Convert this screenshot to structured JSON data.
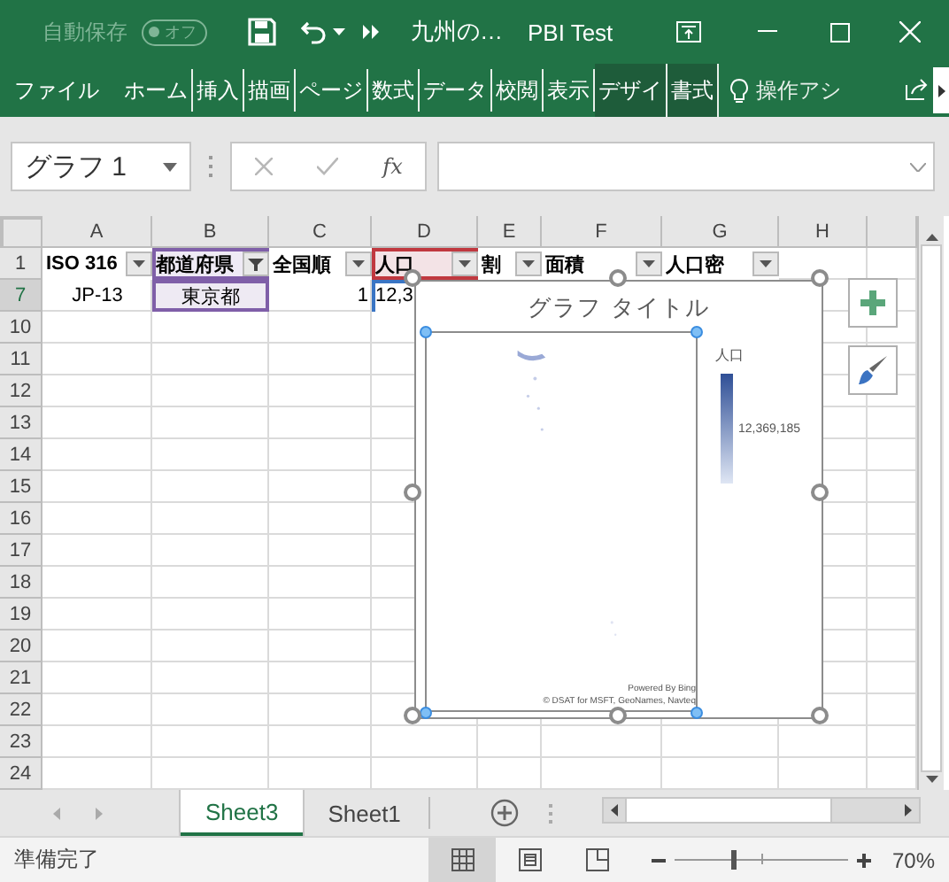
{
  "title_bar": {
    "autosave_label": "自動保存",
    "autosave": {
      "label": "オフ",
      "on": false
    },
    "file_name": "九州の…",
    "title": "PBI Test"
  },
  "ribbon_tabs": [
    {
      "label": "ファイル",
      "contextual": false
    },
    {
      "label": "ホーム",
      "contextual": false
    },
    {
      "label": "挿入",
      "contextual": false
    },
    {
      "label": "描画",
      "contextual": false
    },
    {
      "label": "ページ",
      "contextual": false
    },
    {
      "label": "数式",
      "contextual": false
    },
    {
      "label": "データ",
      "contextual": false
    },
    {
      "label": "校閲",
      "contextual": false
    },
    {
      "label": "表示",
      "contextual": false
    },
    {
      "label": "デザイ",
      "contextual": true
    },
    {
      "label": "書式",
      "contextual": true
    }
  ],
  "tell_me": "操作アシ",
  "formula_bar": {
    "name_box": "グラフ 1",
    "function_label": "fx"
  },
  "sheet": {
    "columns": [
      "A",
      "B",
      "C",
      "D",
      "E",
      "F",
      "G",
      "H"
    ],
    "rows": [
      {
        "label": "1",
        "selected": false,
        "cells": [
          {
            "text": "ISO 316",
            "kind": "header",
            "filtered": false
          },
          {
            "text": "都道府県",
            "kind": "header",
            "filtered": true,
            "color": "#7f5fa8"
          },
          {
            "text": "全国順",
            "kind": "header",
            "filtered": false
          },
          {
            "text": "人口",
            "kind": "header",
            "filtered": false,
            "color": "#c0383f"
          },
          {
            "text": "割",
            "kind": "header",
            "filtered": false
          },
          {
            "text": "面積",
            "kind": "header",
            "filtered": false
          },
          {
            "text": "人口密",
            "kind": "header",
            "filtered": false
          }
        ]
      },
      {
        "label": "7",
        "selected": true,
        "cells": [
          {
            "text": "JP-13",
            "kind": "center"
          },
          {
            "text": "東京都",
            "kind": "center",
            "color": "#7f5fa8"
          },
          {
            "text": "1",
            "kind": "number"
          },
          {
            "text": "12,3",
            "kind": "cut",
            "color": "#3a75c4"
          }
        ]
      },
      {
        "label": "10",
        "selected": false
      },
      {
        "label": "11",
        "selected": false
      },
      {
        "label": "12",
        "selected": false
      },
      {
        "label": "13",
        "selected": false
      },
      {
        "label": "14",
        "selected": false
      },
      {
        "label": "15",
        "selected": false
      },
      {
        "label": "16",
        "selected": false
      },
      {
        "label": "17",
        "selected": false
      },
      {
        "label": "18",
        "selected": false
      },
      {
        "label": "19",
        "selected": false
      },
      {
        "label": "20",
        "selected": false
      },
      {
        "label": "21",
        "selected": false
      },
      {
        "label": "22",
        "selected": false
      },
      {
        "label": "23",
        "selected": false
      },
      {
        "label": "24",
        "selected": false
      }
    ]
  },
  "chart": {
    "selected": true,
    "title": "グラフ タイトル",
    "legend_title": "人口",
    "legend_value": "12,369,185",
    "attribution": [
      "Powered By Bing",
      "© DSAT for MSFT, GeoNames, Navteq"
    ]
  },
  "sheet_tabs": [
    {
      "label": "Sheet3",
      "selected": true
    },
    {
      "label": "Sheet1",
      "selected": false
    }
  ],
  "status_bar": {
    "text": "準備完了",
    "views": [
      {
        "kind": "normal",
        "selected": true
      },
      {
        "kind": "page_layout",
        "selected": false
      },
      {
        "kind": "page_break",
        "selected": false
      }
    ],
    "zoom": {
      "level": 0.34,
      "reading": "70%"
    }
  }
}
